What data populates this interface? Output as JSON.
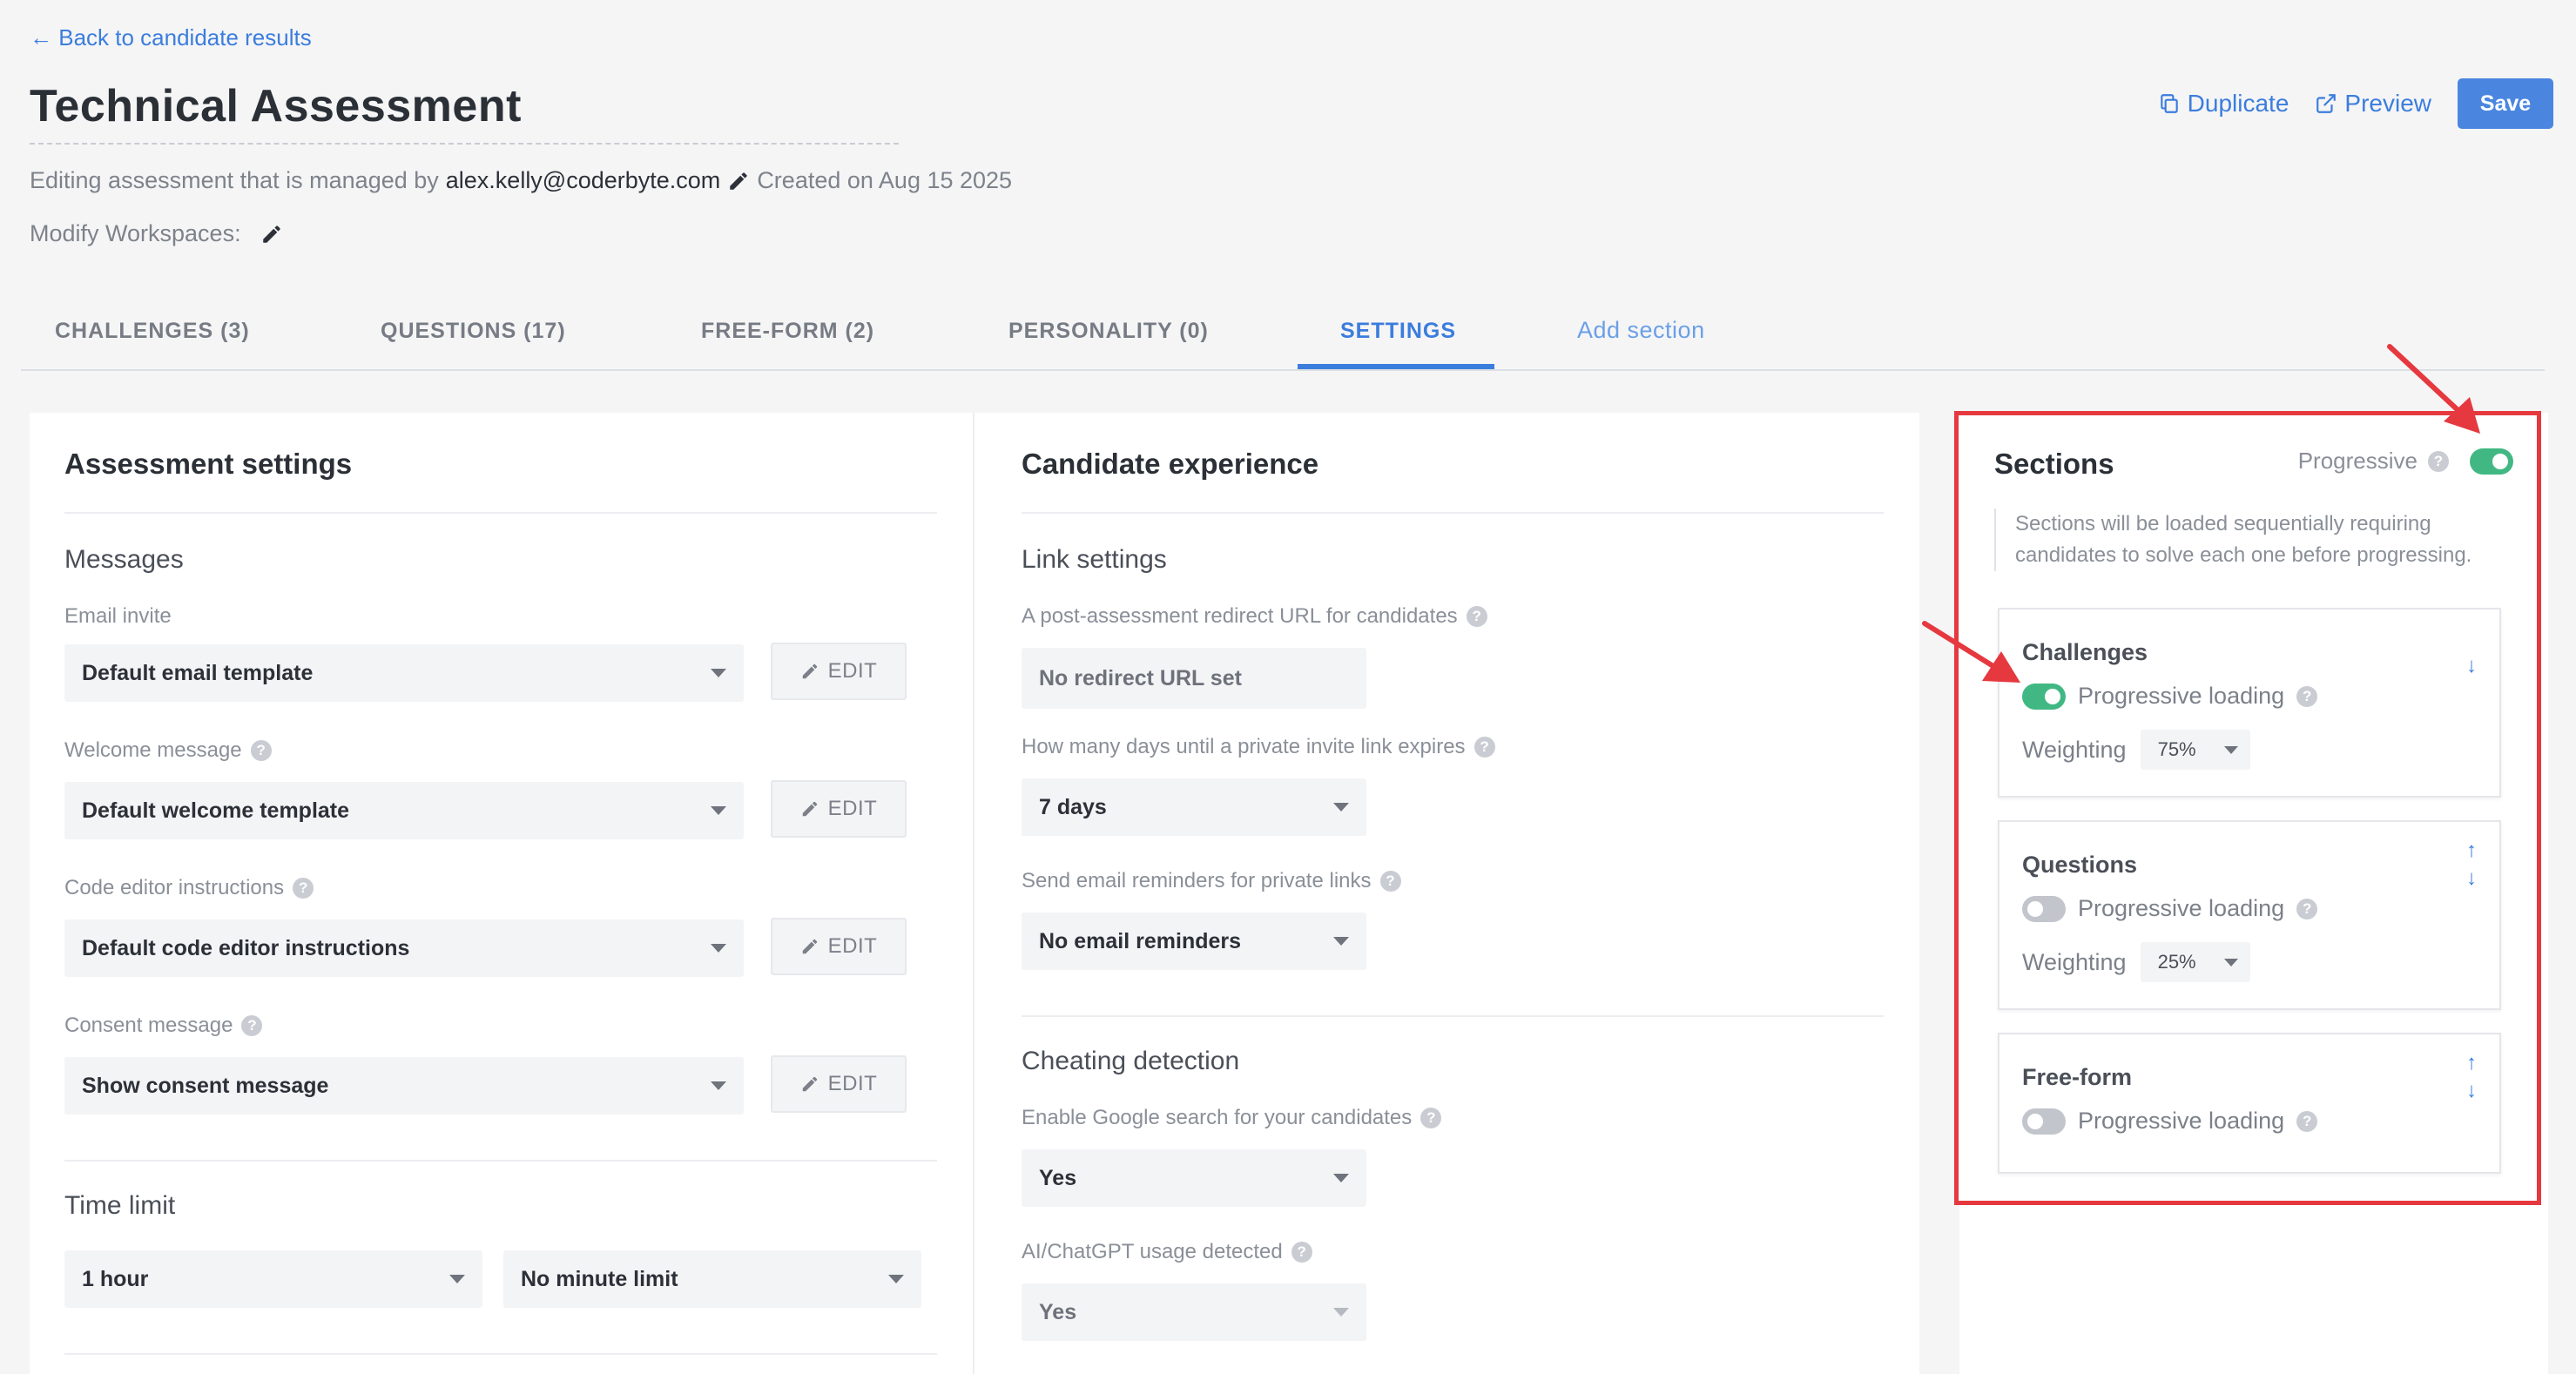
{
  "header": {
    "back_label": "← Back to candidate results",
    "title": "Technical Assessment",
    "managed_prefix": "Editing assessment that is managed by",
    "owner_email": "alex.kelly@coderbyte.com",
    "created_label": "Created on Aug 15 2025",
    "workspaces_label": "Modify Workspaces:",
    "duplicate_label": "Duplicate",
    "preview_label": "Preview",
    "save_label": "Save"
  },
  "tabs": [
    {
      "label": "CHALLENGES (3)"
    },
    {
      "label": "QUESTIONS (17)"
    },
    {
      "label": "FREE-FORM (2)"
    },
    {
      "label": "PERSONALITY (0)"
    },
    {
      "label": "SETTINGS"
    },
    {
      "label": "Add section"
    }
  ],
  "active_tab": "SETTINGS",
  "assessment_settings": {
    "title": "Assessment settings",
    "messages_heading": "Messages",
    "email_invite_label": "Email invite",
    "email_invite_value": "Default email template",
    "welcome_label": "Welcome message",
    "welcome_value": "Default welcome template",
    "code_editor_label": "Code editor instructions",
    "code_editor_value": "Default code editor instructions",
    "consent_label": "Consent message",
    "consent_value": "Show consent message",
    "edit_label": "EDIT",
    "time_limit_heading": "Time limit",
    "hours_value": "1 hour",
    "minutes_value": "No minute limit"
  },
  "candidate_experience": {
    "title": "Candidate experience",
    "link_settings_heading": "Link settings",
    "redirect_label": "A post-assessment redirect URL for candidates",
    "redirect_placeholder": "No redirect URL set",
    "expiry_label": "How many days until a private invite link expires",
    "expiry_value": "7 days",
    "reminders_label": "Send email reminders for private links",
    "reminders_value": "No email reminders",
    "cheating_heading": "Cheating detection",
    "google_label": "Enable Google search for your candidates",
    "google_value": "Yes",
    "ai_label": "AI/ChatGPT usage detected",
    "ai_value": "Yes"
  },
  "sections": {
    "title": "Sections",
    "progressive_label": "Progressive",
    "progressive_on": true,
    "note": "Sections will be loaded sequentially requiring candidates to solve each one before progressing.",
    "progressive_loading_label": "Progressive loading",
    "weighting_label": "Weighting",
    "cards": [
      {
        "title": "Challenges",
        "progressive_loading": true,
        "weighting": "75%"
      },
      {
        "title": "Questions",
        "progressive_loading": false,
        "weighting": "25%"
      },
      {
        "title": "Free-form",
        "progressive_loading": false
      }
    ]
  },
  "colors": {
    "accent": "#3b7ddd",
    "toggle_on": "#41b883",
    "toggle_off": "#c2c5cb",
    "highlight": "#e5393f"
  }
}
